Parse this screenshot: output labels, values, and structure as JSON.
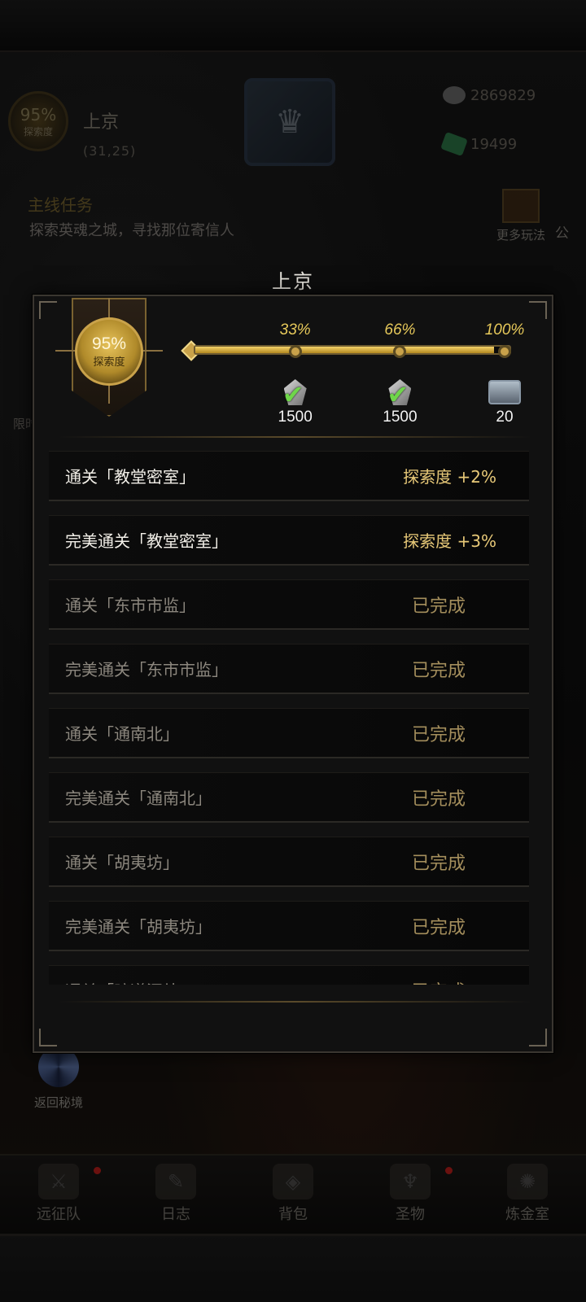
{
  "header": {
    "city_name": "上京",
    "coords": "(31,25)",
    "explore_pct": "95%",
    "explore_label": "探索度",
    "coins": "2869829",
    "gems": "19499"
  },
  "quest": {
    "title": "主线任务",
    "text": "探索英魂之城，寻找那位寄信人"
  },
  "side": {
    "more_play": "更多玩法",
    "cut_label": "公",
    "limit_cut": "限时"
  },
  "portal_label": "返回秘境",
  "nav": [
    "远征队",
    "日志",
    "背包",
    "圣物",
    "炼金室"
  ],
  "modal": {
    "title": "上京",
    "explore_pct": "95%",
    "explore_label": "探索度",
    "progress": 0.95,
    "milestones": [
      {
        "pct": "33%",
        "amount": "1500",
        "claimed": true,
        "reward": "stone-icon"
      },
      {
        "pct": "66%",
        "amount": "1500",
        "claimed": true,
        "reward": "stone-icon"
      },
      {
        "pct": "100%",
        "amount": "20",
        "claimed": false,
        "reward": "chest-icon"
      }
    ],
    "tasks": [
      {
        "name": "通关「教堂密室」",
        "status": "探索度 +2%",
        "done": false
      },
      {
        "name": "完美通关「教堂密室」",
        "status": "探索度 +3%",
        "done": false
      },
      {
        "name": "通关「东市市监」",
        "status": "已完成",
        "done": true
      },
      {
        "name": "完美通关「东市市监」",
        "status": "已完成",
        "done": true
      },
      {
        "name": "通关「通南北」",
        "status": "已完成",
        "done": true
      },
      {
        "name": "完美通关「通南北」",
        "status": "已完成",
        "done": true
      },
      {
        "name": "通关「胡夷坊」",
        "status": "已完成",
        "done": true
      },
      {
        "name": "完美通关「胡夷坊」",
        "status": "已完成",
        "done": true
      },
      {
        "name": "通关「暗道深处」",
        "status": "已完成",
        "done": true
      }
    ]
  },
  "colors": {
    "gold": "#e8c978",
    "done_text": "#8c877e",
    "progress_fill": "#e3bd4a"
  }
}
